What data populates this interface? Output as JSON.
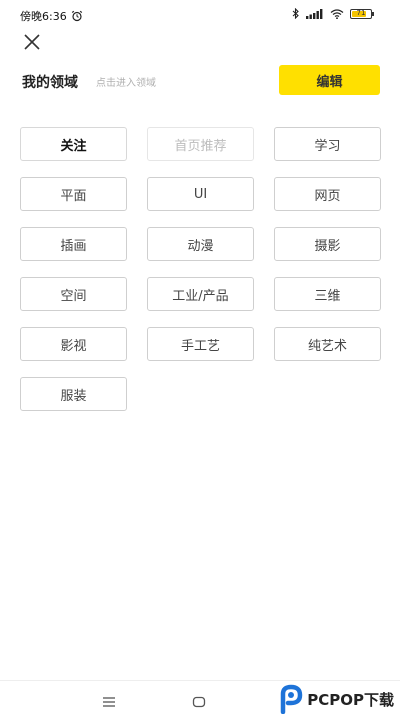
{
  "status_bar": {
    "time": "傍晚6:36",
    "battery_level": "71"
  },
  "header": {
    "title": "我的领域",
    "hint": "点击进入领域",
    "edit_label": "编辑"
  },
  "tags": [
    {
      "label": "关注",
      "state": "active"
    },
    {
      "label": "首页推荐",
      "state": "disabled"
    },
    {
      "label": "学习",
      "state": "normal"
    },
    {
      "label": "平面",
      "state": "normal"
    },
    {
      "label": "UI",
      "state": "normal"
    },
    {
      "label": "网页",
      "state": "normal"
    },
    {
      "label": "插画",
      "state": "normal"
    },
    {
      "label": "动漫",
      "state": "normal"
    },
    {
      "label": "摄影",
      "state": "normal"
    },
    {
      "label": "空间",
      "state": "normal"
    },
    {
      "label": "工业/产品",
      "state": "normal"
    },
    {
      "label": "三维",
      "state": "normal"
    },
    {
      "label": "影视",
      "state": "normal"
    },
    {
      "label": "手工艺",
      "state": "normal"
    },
    {
      "label": "纯艺术",
      "state": "normal"
    },
    {
      "label": "服装",
      "state": "normal"
    }
  ],
  "watermark": {
    "text": "PCPOP下载"
  },
  "colors": {
    "accent": "#ffe000",
    "battery": "#f4c400"
  },
  "icons": [
    "alarm-icon",
    "bluetooth-icon",
    "signal-icon",
    "wifi-icon",
    "battery-icon",
    "close-icon",
    "menu-icon",
    "home-icon",
    "pcpop-logo-icon"
  ]
}
